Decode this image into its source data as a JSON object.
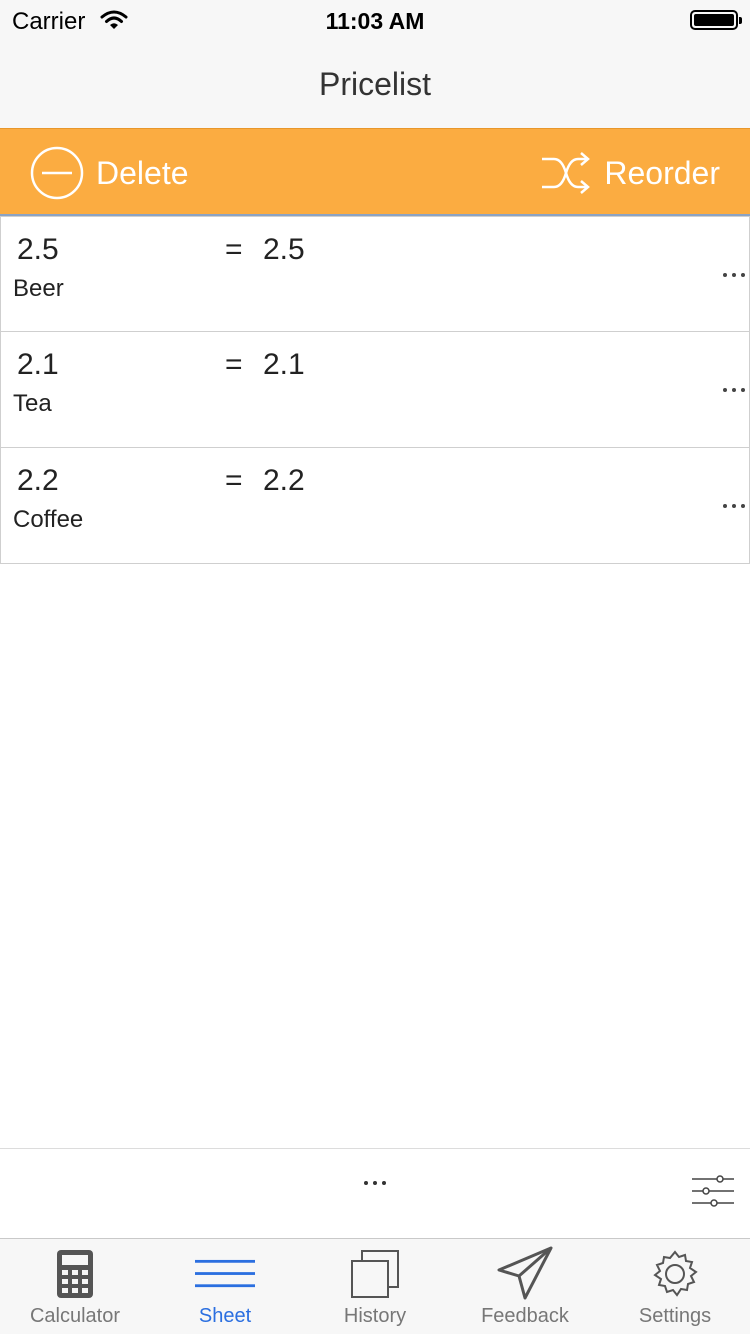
{
  "status_bar": {
    "carrier": "Carrier",
    "time": "11:03 AM"
  },
  "nav": {
    "title": "Pricelist"
  },
  "actions": {
    "delete_label": "Delete",
    "reorder_label": "Reorder"
  },
  "rows": [
    {
      "expression": "2.5",
      "equals": "=",
      "result": "2.5",
      "name": "Beer"
    },
    {
      "expression": "2.1",
      "equals": "=",
      "result": "2.1",
      "name": "Tea"
    },
    {
      "expression": "2.2",
      "equals": "=",
      "result": "2.2",
      "name": "Coffee"
    }
  ],
  "tabs": [
    {
      "label": "Calculator",
      "icon": "calculator-icon"
    },
    {
      "label": "Sheet",
      "icon": "sheet-icon",
      "active": true
    },
    {
      "label": "History",
      "icon": "history-icon"
    },
    {
      "label": "Feedback",
      "icon": "feedback-icon"
    },
    {
      "label": "Settings",
      "icon": "settings-icon"
    }
  ],
  "colors": {
    "accent_orange": "#fbac41",
    "active_tab": "#2b6fe0",
    "inactive_tab": "#777777"
  }
}
